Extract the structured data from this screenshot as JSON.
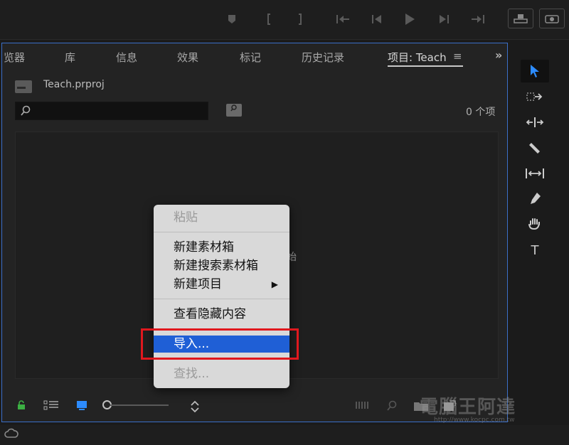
{
  "transport": {
    "icons": [
      "marker-icon",
      "in-point-icon",
      "out-point-icon",
      "go-to-in-icon",
      "step-back-icon",
      "play-icon",
      "step-forward-icon",
      "go-to-out-icon",
      "insert-icon",
      "export-frame-icon"
    ]
  },
  "panel": {
    "tabs": [
      {
        "label": "览器"
      },
      {
        "label": "库"
      },
      {
        "label": "信息"
      },
      {
        "label": "效果"
      },
      {
        "label": "标记"
      },
      {
        "label": "历史记录"
      },
      {
        "label": "项目: Teach"
      }
    ],
    "menu_glyph": "≡",
    "more_glyph": "»",
    "project_file": "Teach.prproj",
    "item_count": "0 个项",
    "hint_text": "始"
  },
  "context_menu": {
    "items": [
      {
        "label": "粘贴",
        "state": "disabled"
      },
      {
        "label": "新建素材箱",
        "state": "enabled"
      },
      {
        "label": "新建搜索素材箱",
        "state": "enabled"
      },
      {
        "label": "新建项目",
        "state": "enabled",
        "submenu": "▶"
      },
      {
        "label": "查看隐藏内容",
        "state": "enabled"
      },
      {
        "label": "导入...",
        "state": "highlighted"
      },
      {
        "label": "查找...",
        "state": "disabled"
      }
    ]
  },
  "tools": {
    "icons": [
      "selection-tool-icon",
      "track-select-tool-icon",
      "ripple-edit-tool-icon",
      "razor-tool-icon",
      "slip-tool-icon",
      "pen-tool-icon",
      "hand-tool-icon",
      "type-tool-icon"
    ],
    "type_glyph": "T"
  },
  "watermark": {
    "text": "電腦王阿達",
    "url": "http://www.kocpc.com.tw"
  },
  "colors": {
    "panel_border": "#3b6fc9",
    "menu_highlight": "#1f5fd6",
    "annotation_red": "#e0181e",
    "lock_green": "#3cb043",
    "active_blue": "#2d8cff"
  }
}
